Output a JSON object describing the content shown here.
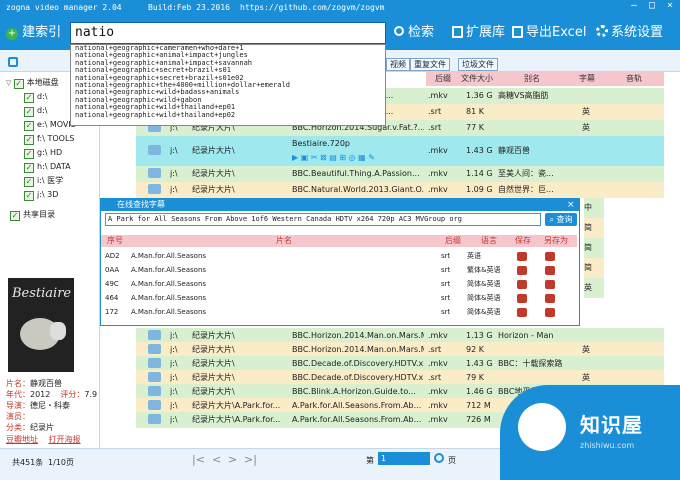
{
  "title": {
    "app": "zogna video manager 2.04",
    "build": "Build:Feb 23.2016",
    "url": "https://github.com/zogvm/zogvm"
  },
  "toolbar": {
    "index_label": "建索引",
    "search_value": "natio",
    "search_label": "检索",
    "ext_label": "扩展库",
    "export_label": "导出Excel",
    "settings_label": "系统设置"
  },
  "suggestions": [
    "national+geographic+cameramen+who+dare+1",
    "national+geographic+animal+impact+jungles",
    "national+geographic+animal+impact+savannah",
    "national+geographic+secret+brazil+s01",
    "national+geographic+secret+brazil+s01e02",
    "national+geographic+the+4000+million+dollar+emerald",
    "national+geographic+wild+badass+animals",
    "national+geographic+wild+gabon",
    "national+geographic+wild+thailand+ep01",
    "national+geographic+wild+thailand+ep02"
  ],
  "subbar": {
    "btn1": "视频",
    "btn2": "重复文件",
    "btn3": "垃圾文件"
  },
  "tree": {
    "root": "本地磁盘",
    "items": [
      "d:\\",
      "d:\\",
      "e:\\ MOVIE",
      "f:\\ TOOLS",
      "g:\\ HD",
      "h:\\ DATA",
      "i:\\ 医学",
      "j:\\ 3D"
    ],
    "shared": "共享目录"
  },
  "columns": {
    "ext": "后缀",
    "size": "文件大小",
    "alias": "别名",
    "subtitle": "字幕",
    "audio": "音轨"
  },
  "rows_top": [
    {
      "path": "j:\\",
      "name": "纪录片大片\\",
      "file": "BBC.Horizon.2014.Fat.?...",
      "ext": ".mkv",
      "size": "1.36 G",
      "alias": "高糖VS高脂肪",
      "sub": ""
    },
    {
      "path": "j:\\",
      "name": "纪录片大片\\",
      "file": "BBC.Horizon.2014.Fat.?...",
      "ext": ".srt",
      "size": "81 K",
      "alias": "",
      "sub": "英"
    },
    {
      "path": "j:\\",
      "name": "纪录片大片\\",
      "file": "BBC.Horizon.2014.Sugar.v.Fat.?...",
      "ext": ".srt",
      "size": "77 K",
      "alias": "",
      "sub": "英"
    }
  ],
  "selected": {
    "path": "j:\\",
    "name": "纪录片大片\\",
    "file": "Bestiaire.720p",
    "ext": ".mkv",
    "size": "1.43 G",
    "alias": "静观百兽"
  },
  "rows_mid": [
    {
      "path": "j:\\",
      "name": "纪录片大片\\",
      "file": "BBC.Beautiful.Thing.A.Passion...",
      "ext": ".mkv",
      "size": "1.14 G",
      "alias": "至美人间：瓷..."
    },
    {
      "path": "j:\\",
      "name": "纪录片大片\\",
      "file": "BBC.Natural.World.2013.Giant.O...",
      "ext": ".mkv",
      "size": "1.09 G",
      "alias": "自然世界：巨..."
    }
  ],
  "right_subs": [
    "中",
    "简",
    "简",
    "简",
    "英"
  ],
  "dialog": {
    "title": "在线查找字幕",
    "query": "A Park for All Seasons From Above 1of6 Western Canada HDTV x264 720p AC3 MVGroup org",
    "search_btn": "查询",
    "headers": [
      "序号",
      "片名",
      "后缀",
      "语言",
      "保存",
      "另存为"
    ],
    "rows": [
      {
        "id": "AD2",
        "title": "A.Man.for.All.Seasons",
        "ext": "srt",
        "lang": "英语"
      },
      {
        "id": "0AA",
        "title": "A.Man.for.All.Seasons",
        "ext": "srt",
        "lang": "繁体&英语"
      },
      {
        "id": "49C",
        "title": "A.Man.for.All.Seasons",
        "ext": "srt",
        "lang": "简体&英语"
      },
      {
        "id": "464",
        "title": "A.Man.for.All.Seasons",
        "ext": "srt",
        "lang": "简体&英语"
      },
      {
        "id": "172",
        "title": "A.Man.for.All.Seasons",
        "ext": "srt",
        "lang": "简体&英语"
      }
    ]
  },
  "rows_bottom": [
    {
      "path": "j:\\",
      "name": "纪录片大片\\",
      "file": "BBC.Horizon.2014.Man.on.Mars.M...",
      "ext": ".mkv",
      "size": "1.13 G",
      "alias": "Horizon - Man",
      "sub": ""
    },
    {
      "path": "j:\\",
      "name": "纪录片大片\\",
      "file": "BBC.Horizon.2014.Man.on.Mars.M...",
      "ext": ".srt",
      "size": "92 K",
      "alias": "",
      "sub": "英"
    },
    {
      "path": "j:\\",
      "name": "纪录片大片\\",
      "file": "BBC.Decade.of.Discovery.HDTV.x...",
      "ext": ".mkv",
      "size": "1.43 G",
      "alias": "BBC：十载探索路",
      "sub": ""
    },
    {
      "path": "j:\\",
      "name": "纪录片大片\\",
      "file": "BBC.Decade.of.Discovery.HDTV.x...",
      "ext": ".srt",
      "size": "79 K",
      "alias": "",
      "sub": "英"
    },
    {
      "path": "j:\\",
      "name": "纪录片大片\\",
      "file": "BBC.Blink.A.Horizon.Guide.to...",
      "ext": ".mkv",
      "size": "1.46 G",
      "alias": "BBC地平线：火星",
      "sub": ""
    },
    {
      "path": "j:\\",
      "name": "纪录片大片\\A.Park.for...",
      "file": "A.Park.for.All.Seasons.From.Ab...",
      "ext": ".mkv",
      "size": "712 M",
      "alias": "",
      "sub": ""
    },
    {
      "path": "j:\\",
      "name": "纪录片大片\\A.Park.for...",
      "file": "A.Park.for.All.Seasons.From.Ab...",
      "ext": ".mkv",
      "size": "726 M",
      "alias": "",
      "sub": ""
    }
  ],
  "poster_title": "Bestiaire",
  "info": {
    "name_k": "片名：",
    "name_v": "静观百兽",
    "year_k": "年代：",
    "year_v": "2012",
    "score_k": "评分：",
    "score_v": "7.9",
    "director_k": "导演：",
    "director_v": "德尼・科泰",
    "actor_k": "演员：",
    "actor_v": "",
    "type_k": "分类：",
    "type_v": "纪录片",
    "link1": "豆瓣地址",
    "link2": "打开海报"
  },
  "footer": {
    "total": "共451条",
    "pages": "1/10页",
    "goto_pre": "第",
    "page_value": "1",
    "goto_post": "页"
  },
  "watermark": {
    "brand": "知识屋",
    "site": "zhishiwu.com"
  }
}
